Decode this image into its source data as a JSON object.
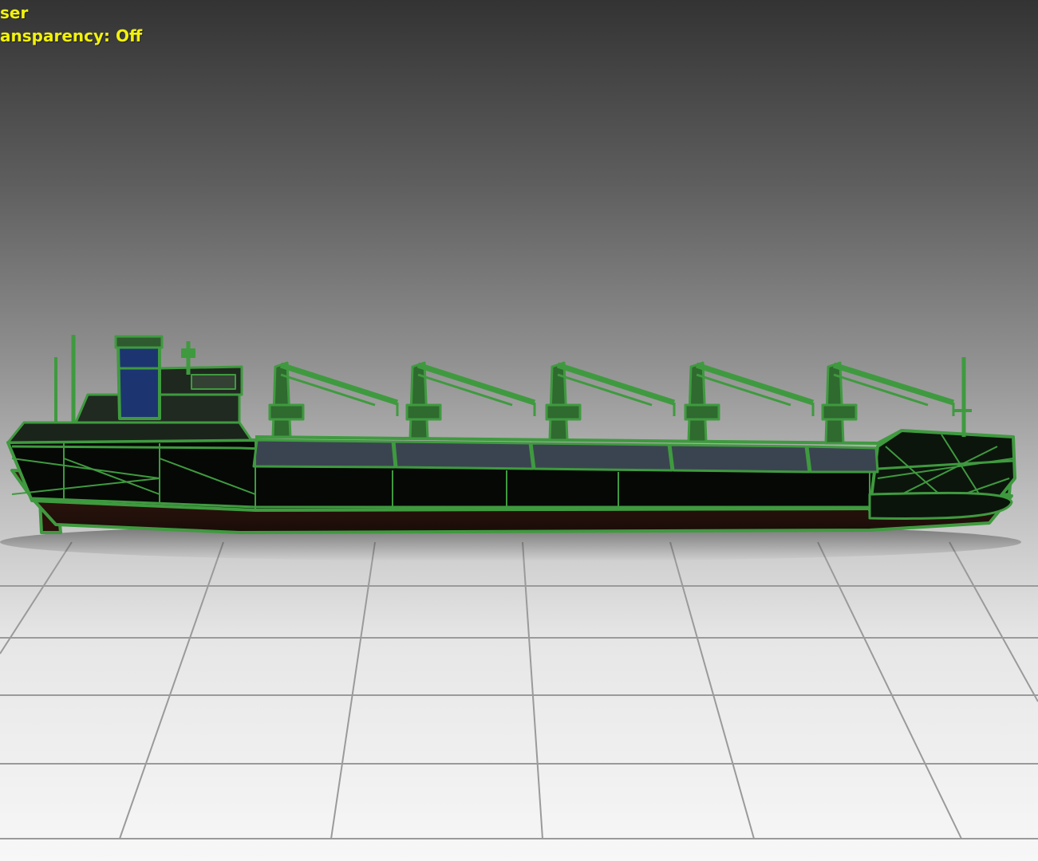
{
  "viewport": {
    "overlay": {
      "line1": "ser",
      "line2": "ansparency: Off",
      "color": "#f2f20a"
    }
  },
  "colors": {
    "wireframe": "#3f9a3f",
    "hull": "#050805",
    "deck_hatch": "#3a4450",
    "funnel": "#1c3570",
    "grid_line": "#9a9a9a"
  },
  "icons": [
    "cargo-ship-model"
  ]
}
